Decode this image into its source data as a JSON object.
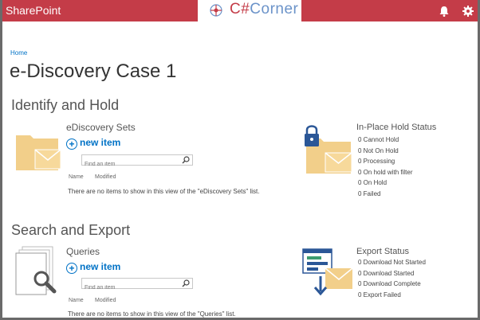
{
  "suite": {
    "brand": "SharePoint",
    "logo_text_1": "C#",
    "logo_text_2": "Corner",
    "icons": [
      "bell-icon",
      "gear-icon"
    ],
    "accent_color": "#c43c48"
  },
  "breadcrumb": "Home",
  "page_title": "e-Discovery Case 1",
  "sections": {
    "identify": {
      "title": "Identify and Hold",
      "list_title": "eDiscovery Sets",
      "new_item": "new item",
      "search_placeholder": "Find an item",
      "columns": [
        "Name",
        "Modified"
      ],
      "empty_message": "There are no items to show in this view of the \"eDiscovery Sets\" list.",
      "status_title": "In-Place Hold Status",
      "status_items": [
        "0 Cannot Hold",
        "0 Not On Hold",
        "0 Processing",
        "0 On hold with filter",
        "0 On Hold",
        "0 Failed"
      ]
    },
    "search": {
      "title": "Search and Export",
      "list_title": "Queries",
      "new_item": "new item",
      "search_placeholder": "Find an item",
      "columns": [
        "Name",
        "Modified"
      ],
      "empty_message": "There are no items to show in this view of the \"Queries\" list.",
      "status_title": "Export Status",
      "status_items": [
        "0 Download Not Started",
        "0 Download Started",
        "0 Download Complete",
        "0 Export Failed"
      ]
    }
  }
}
